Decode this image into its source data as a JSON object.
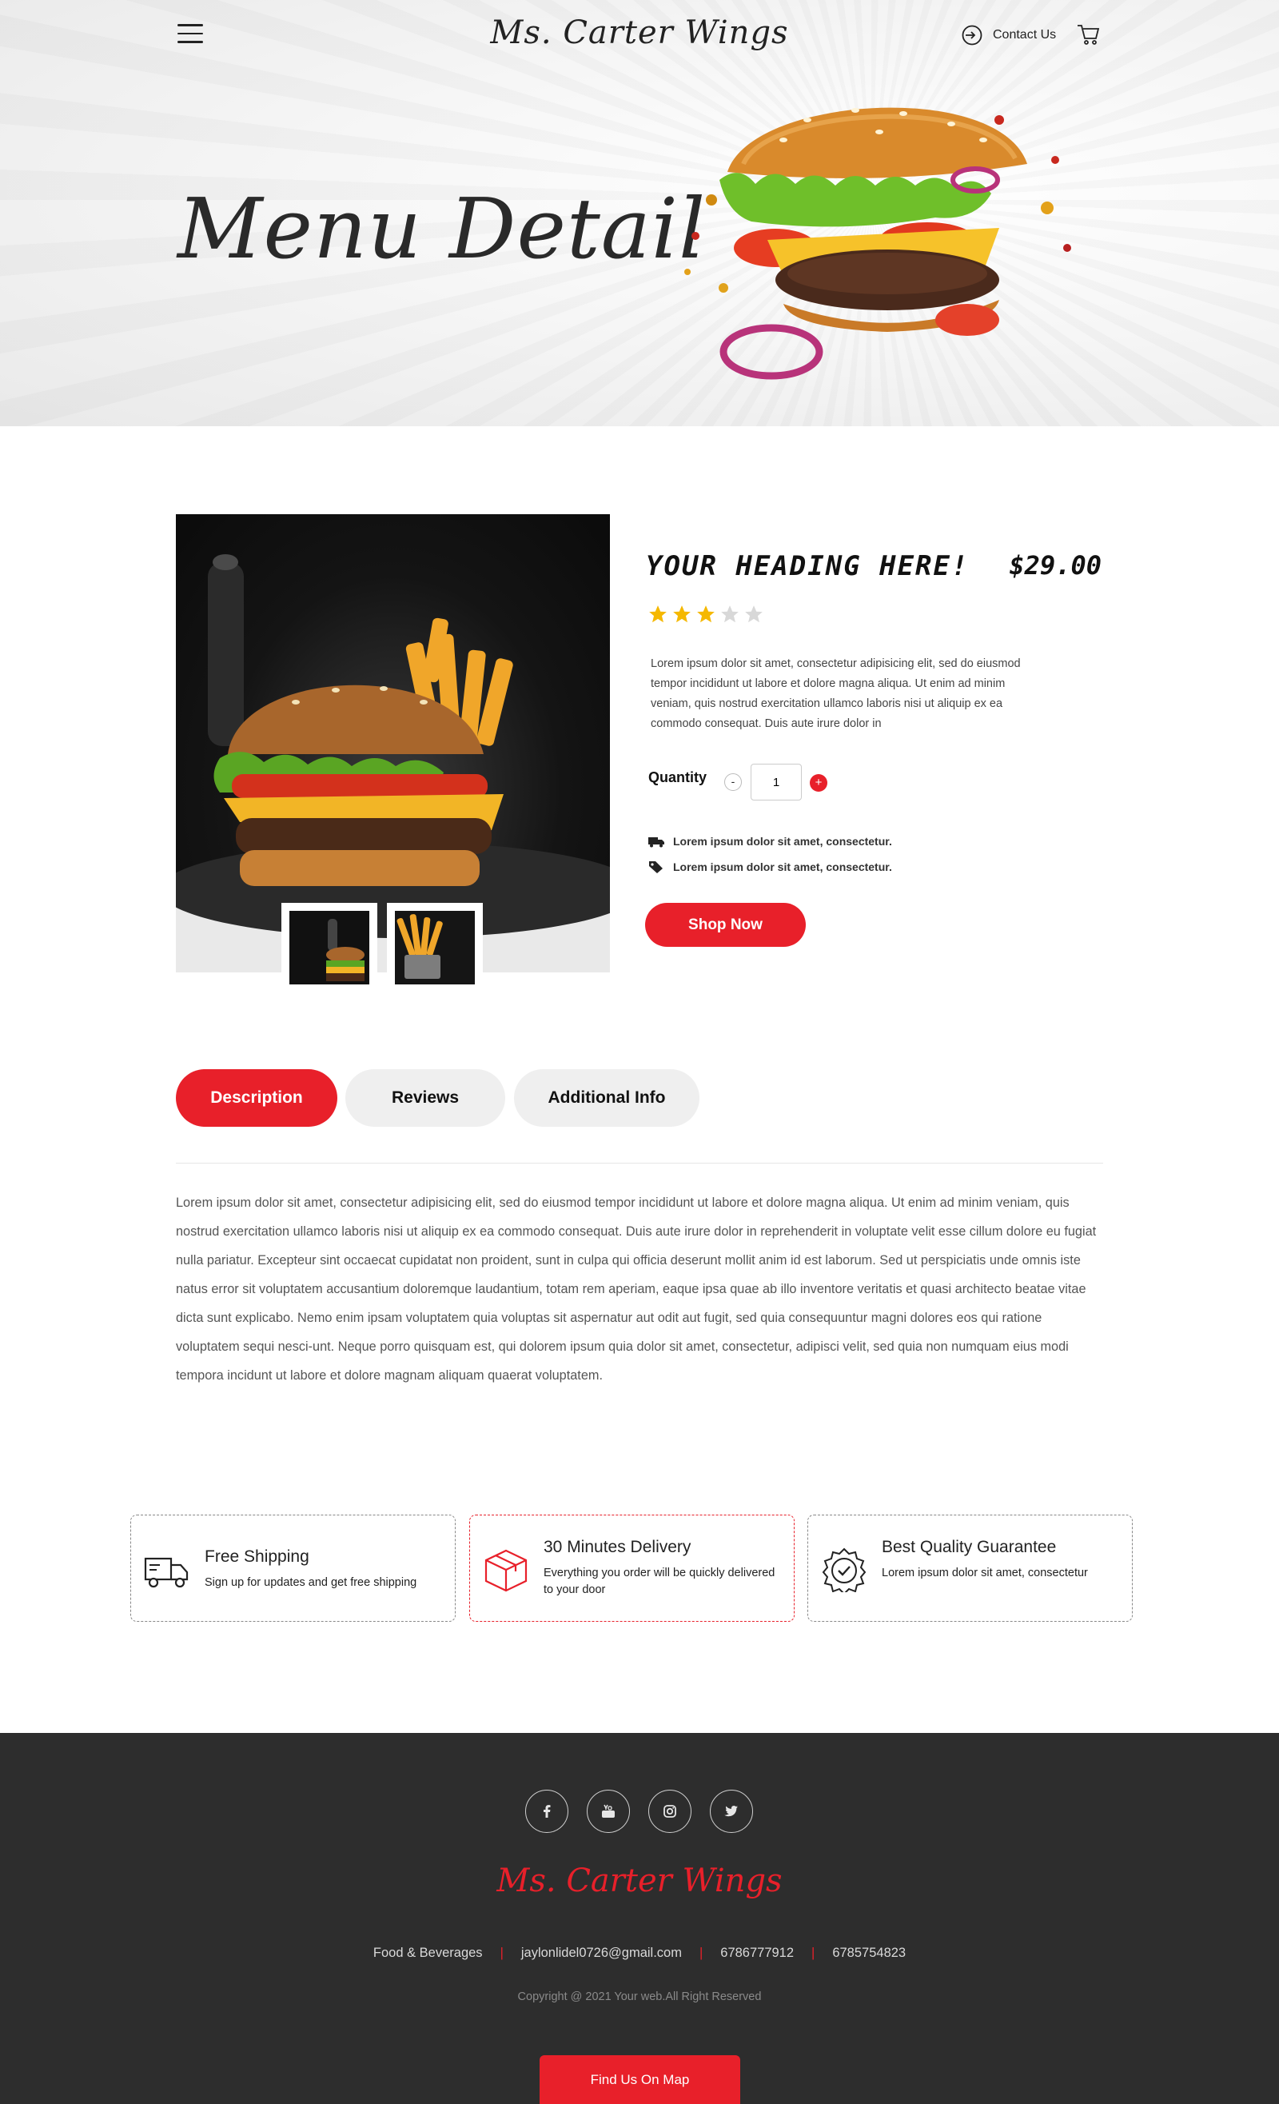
{
  "header": {
    "logo": "Ms. Carter Wings",
    "contact_label": "Contact Us",
    "hero_title": "Menu Detail"
  },
  "product": {
    "heading": "YOUR HEADING HERE!",
    "price": "$29.00",
    "rating": 3,
    "rating_max": 5,
    "description": "Lorem ipsum dolor sit amet, consectetur adipisicing elit, sed do eiusmod tempor incididunt ut labore et dolore magna aliqua. Ut enim ad minim veniam, quis nostrud exercitation ullamco laboris nisi ut aliquip ex ea commodo consequat. Duis aute irure dolor in",
    "quantity_label": "Quantity",
    "quantity_value": "1",
    "minus": "-",
    "plus": "+",
    "features": [
      "Lorem ipsum dolor sit amet, consectetur.",
      "Lorem ipsum dolor sit amet, consectetur."
    ],
    "cta": "Shop Now"
  },
  "tabs": [
    "Description",
    "Reviews",
    "Additional Info"
  ],
  "long_description": "Lorem ipsum dolor sit amet, consectetur adipisicing elit, sed do eiusmod tempor incididunt ut labore et dolore magna aliqua. Ut enim ad minim veniam, quis nostrud exercitation ullamco laboris nisi ut aliquip ex ea commodo consequat. Duis aute irure dolor in reprehenderit in voluptate velit esse cillum dolore eu fugiat nulla pariatur. Excepteur sint occaecat cupidatat non proident, sunt in culpa qui officia deserunt mollit anim id est laborum. Sed ut perspiciatis unde omnis iste natus error sit voluptatem accusantium doloremque laudantium, totam rem aperiam, eaque ipsa quae ab illo inventore veritatis et quasi architecto beatae vitae dicta sunt explicabo. Nemo enim ipsam voluptatem quia voluptas sit aspernatur aut odit aut fugit, sed quia consequuntur magni dolores eos qui ratione voluptatem sequi nesci-unt. Neque porro quisquam est, qui dolorem ipsum quia dolor sit amet, consectetur, adipisci velit, sed quia non numquam eius modi tempora incidunt ut labore et dolore magnam aliquam quaerat voluptatem.",
  "feature_boxes": [
    {
      "title": "Free Shipping",
      "subtitle": "Sign up for updates and get free shipping",
      "icon": "truck-icon"
    },
    {
      "title": "30 Minutes Delivery",
      "subtitle": "Everything you order will be quickly delivered to your door",
      "icon": "box-icon"
    },
    {
      "title": "Best Quality Guarantee",
      "subtitle": "Lorem ipsum dolor sit amet, consectetur",
      "icon": "quality-badge-icon"
    }
  ],
  "footer": {
    "social": [
      "facebook-icon",
      "youtube-icon",
      "instagram-icon",
      "twitter-icon"
    ],
    "logo": "Ms. Carter Wings",
    "category": "Food & Beverages",
    "email": "jaylonlidel0726@gmail.com",
    "phone1": "6786777912",
    "phone2": "6785754823",
    "copyright": "Copyright @ 2021 Your web.All Right Reserved",
    "map_button": "Find Us On Map"
  },
  "colors": {
    "accent": "#e8202a",
    "footer_bg": "#2d2d2d",
    "star_filled": "#f5b800",
    "star_empty": "#d8d8d8"
  }
}
